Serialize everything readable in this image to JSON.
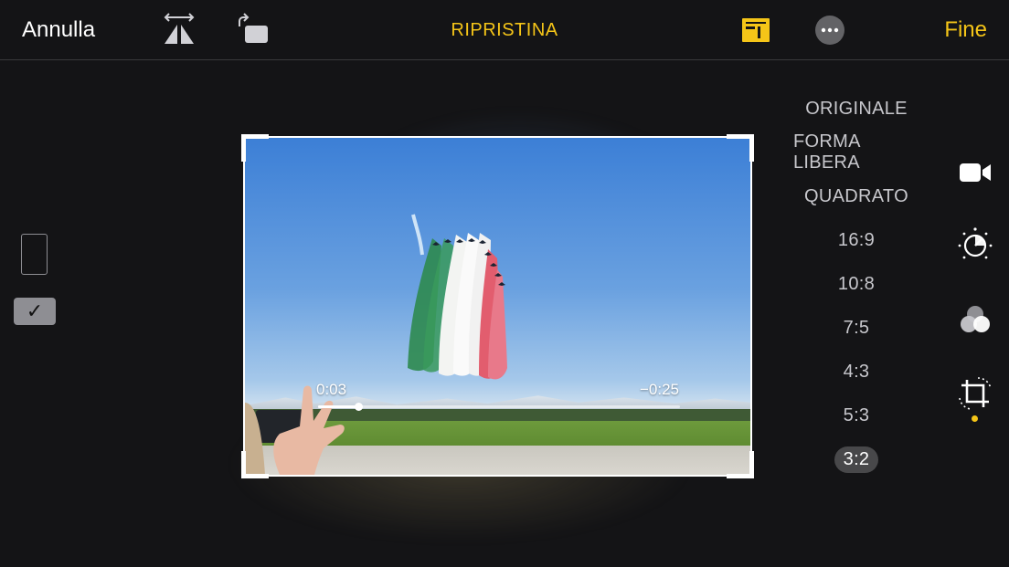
{
  "topbar": {
    "cancel_label": "Annulla",
    "reset_label": "RIPRISTINA",
    "done_label": "Fine",
    "icons": [
      "flip-horizontal-icon",
      "rotate-icon",
      "aspect-ratio-icon",
      "more-options-icon"
    ]
  },
  "orientation": {
    "icons": [
      "portrait-orientation-icon",
      "checkmark-icon"
    ],
    "check_glyph": "✓"
  },
  "video": {
    "elapsed": "0:03",
    "remaining": "−0:25",
    "progress": 0.11
  },
  "aspect_ratios": {
    "items": [
      "ORIGINALE",
      "FORMA LIBERA",
      "QUADRATO",
      "16:9",
      "10:8",
      "7:5",
      "4:3",
      "5:3",
      "3:2"
    ],
    "selected": "3:2"
  },
  "side_tools": {
    "icons": [
      "video-camera-icon",
      "adjust-dial-icon",
      "filters-icon",
      "crop-rotate-icon"
    ],
    "active": "crop-rotate-icon"
  },
  "colors": {
    "accent": "#f5c518",
    "background": "#141416",
    "selected_pill": "#48484a",
    "inactive_text": "#c7c7cc"
  }
}
